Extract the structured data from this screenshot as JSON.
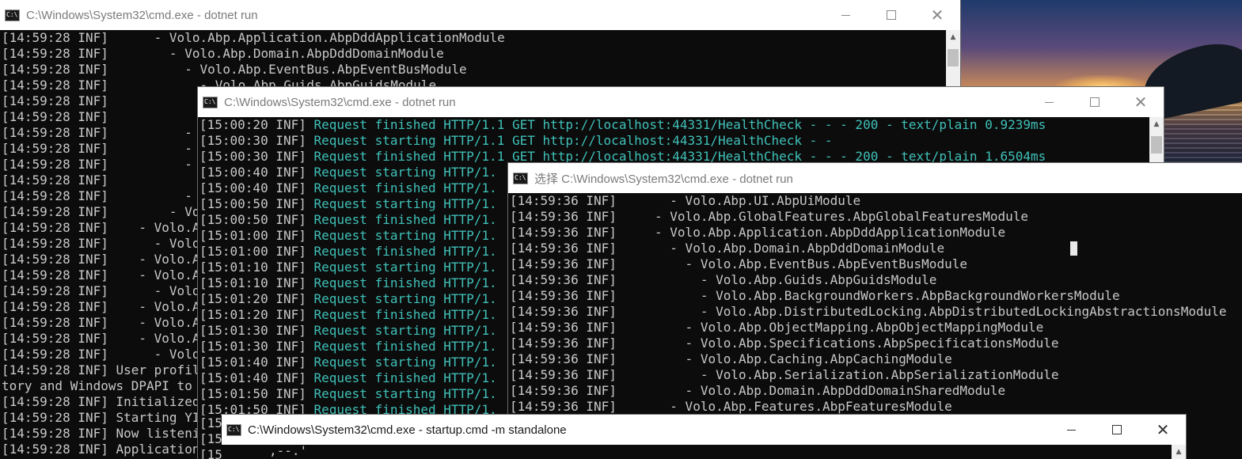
{
  "windows": {
    "w1": {
      "title": "C:\\Windows\\System32\\cmd.exe - dotnet  run",
      "lines": [
        "[14:59:28 INF]      - Volo.Abp.Application.AbpDddApplicationModule",
        "[14:59:28 INF]        - Volo.Abp.Domain.AbpDddDomainModule",
        "[14:59:28 INF]          - Volo.Abp.EventBus.AbpEventBusModule",
        "[14:59:28 INF]            - Volo.Abp.Guids.AbpGuidsModule",
        "[14:59:28 INF]",
        "[14:59:28 INF]",
        "[14:59:28 INF]          - V",
        "[14:59:28 INF]          - V",
        "[14:59:28 INF]          - V",
        "[14:59:28 INF]",
        "[14:59:28 INF]          - V",
        "[14:59:28 INF]        - Vol",
        "[14:59:28 INF]    - Volo.Ab",
        "[14:59:28 INF]      - Volo.",
        "[14:59:28 INF]    - Volo.Ab",
        "[14:59:28 INF]    - Volo.Ab",
        "[14:59:28 INF]      - Volo.",
        "[14:59:28 INF]    - Volo.Ab",
        "[14:59:28 INF]    - Volo.Ab",
        "[14:59:28 INF]    - Volo.Ab",
        "[14:59:28 INF]      - Volo.",
        "[14:59:28 INF] User profil",
        "tory and Windows DPAPI to",
        "[14:59:28 INF] Initialized",
        "[14:59:28 INF] Starting YI",
        "[14:59:28 INF] Now listeni",
        "[14:59:28 INF] Application"
      ]
    },
    "w2": {
      "title": "C:\\Windows\\System32\\cmd.exe - dotnet  run",
      "lines": [
        {
          "ts": "[15:00:20 INF] ",
          "msg": "Request finished HTTP/1.1 GET http://localhost:44331/HealthCheck - - - 200 - text/plain 0.9239ms"
        },
        {
          "ts": "[15:00:30 INF] ",
          "msg": "Request starting HTTP/1.1 GET http://localhost:44331/HealthCheck - -"
        },
        {
          "ts": "[15:00:30 INF] ",
          "msg": "Request finished HTTP/1.1 GET http://localhost:44331/HealthCheck - - - 200 - text/plain 1.6504ms"
        },
        {
          "ts": "[15:00:40 INF] ",
          "msg": "Request starting HTTP/1."
        },
        {
          "ts": "[15:00:40 INF] ",
          "msg": "Request finished HTTP/1."
        },
        {
          "ts": "[15:00:50 INF] ",
          "msg": "Request starting HTTP/1."
        },
        {
          "ts": "[15:00:50 INF] ",
          "msg": "Request finished HTTP/1."
        },
        {
          "ts": "[15:01:00 INF] ",
          "msg": "Request starting HTTP/1."
        },
        {
          "ts": "[15:01:00 INF] ",
          "msg": "Request finished HTTP/1."
        },
        {
          "ts": "[15:01:10 INF] ",
          "msg": "Request starting HTTP/1."
        },
        {
          "ts": "[15:01:10 INF] ",
          "msg": "Request finished HTTP/1."
        },
        {
          "ts": "[15:01:20 INF] ",
          "msg": "Request starting HTTP/1."
        },
        {
          "ts": "[15:01:20 INF] ",
          "msg": "Request finished HTTP/1."
        },
        {
          "ts": "[15:01:30 INF] ",
          "msg": "Request starting HTTP/1."
        },
        {
          "ts": "[15:01:30 INF] ",
          "msg": "Request finished HTTP/1."
        },
        {
          "ts": "[15:01:40 INF] ",
          "msg": "Request starting HTTP/1."
        },
        {
          "ts": "[15:01:40 INF] ",
          "msg": "Request finished HTTP/1."
        },
        {
          "ts": "[15:01:50 INF] ",
          "msg": "Request starting HTTP/1."
        },
        {
          "ts": "[15:01:50 INF] ",
          "msg": "Request finished HTTP/1."
        }
      ]
    },
    "w3": {
      "title": "选择 C:\\Windows\\System32\\cmd.exe - dotnet  run",
      "lines": [
        "[14:59:36 INF]       - Volo.Abp.UI.AbpUiModule",
        "[14:59:36 INF]     - Volo.Abp.GlobalFeatures.AbpGlobalFeaturesModule",
        "[14:59:36 INF]     - Volo.Abp.Application.AbpDddApplicationModule",
        "[14:59:36 INF]       - Volo.Abp.Domain.AbpDddDomainModule",
        "[14:59:36 INF]         - Volo.Abp.EventBus.AbpEventBusModule",
        "[14:59:36 INF]           - Volo.Abp.Guids.AbpGuidsModule",
        "[14:59:36 INF]           - Volo.Abp.BackgroundWorkers.AbpBackgroundWorkersModule",
        "[14:59:36 INF]           - Volo.Abp.DistributedLocking.AbpDistributedLockingAbstractionsModule",
        "[14:59:36 INF]         - Volo.Abp.ObjectMapping.AbpObjectMappingModule",
        "[14:59:36 INF]         - Volo.Abp.Specifications.AbpSpecificationsModule",
        "[14:59:36 INF]         - Volo.Abp.Caching.AbpCachingModule",
        "[14:59:36 INF]           - Volo.Abp.Serialization.AbpSerializationModule",
        "[14:59:36 INF]         - Volo.Abp.Domain.AbpDddDomainSharedModule",
        "[14:59:36 INF]       - Volo.Abp.Features.AbpFeaturesModule"
      ]
    },
    "w4": {
      "title": "C:\\Windows\\System32\\cmd.exe - startup.cmd  -m standalone"
    },
    "w2_partial_lines": [
      "[15",
      "[15",
      "[15"
    ],
    "w2_tail_glyph": ",--.'"
  }
}
